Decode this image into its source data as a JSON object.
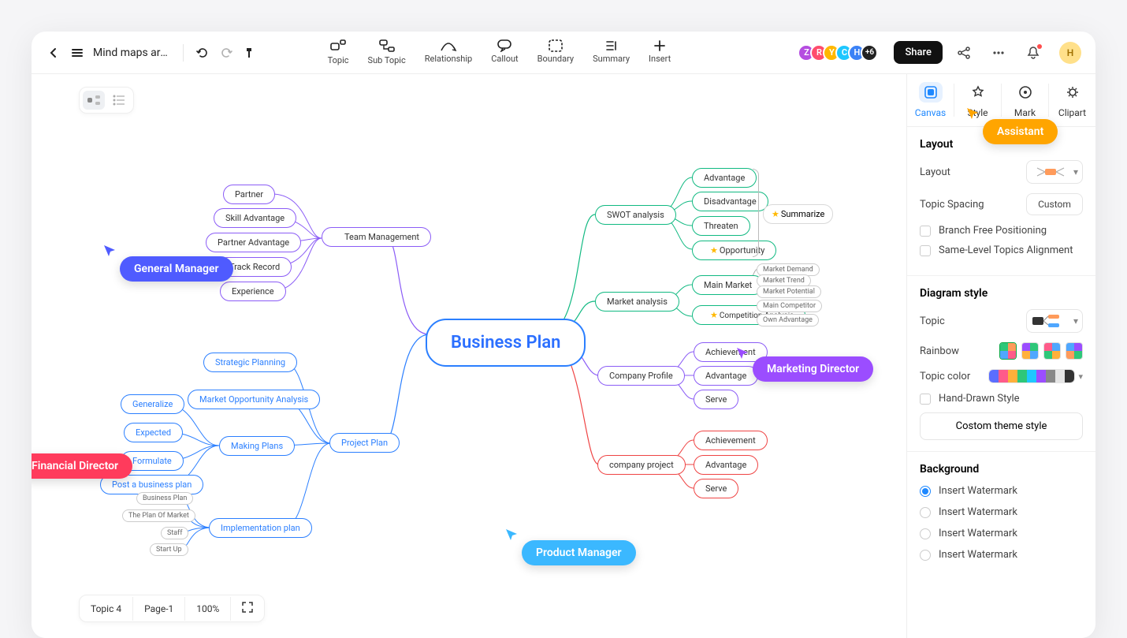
{
  "topbar": {
    "title": "Mind maps are ..."
  },
  "toolbar": [
    {
      "label": "Topic",
      "name": "topic-button"
    },
    {
      "label": "Sub Topic",
      "name": "subtopic-button"
    },
    {
      "label": "Relationship",
      "name": "relationship-button"
    },
    {
      "label": "Callout",
      "name": "callout-button"
    },
    {
      "label": "Boundary",
      "name": "boundary-button"
    },
    {
      "label": "Summary",
      "name": "summary-button"
    },
    {
      "label": "Insert",
      "name": "insert-button"
    }
  ],
  "avatars": [
    "Z",
    "R",
    "Y",
    "C",
    "H"
  ],
  "avatarOverflow": "+6",
  "share": "Share",
  "me": "H",
  "status": {
    "topic": "Topic 4",
    "page": "Page-1",
    "zoom": "100%"
  },
  "panel": {
    "tabs": [
      "Canvas",
      "Style",
      "Mark",
      "Clipart"
    ],
    "layout": {
      "title": "Layout",
      "layoutLabel": "Layout",
      "topicSpacing": "Topic Spacing",
      "custom": "Custom",
      "branchFree": "Branch Free Positioning",
      "sameLevel": "Same-Level Topics Alignment"
    },
    "diagram": {
      "title": "Diagram style",
      "topic": "Topic",
      "rainbow": "Rainbow",
      "topicColor": "Topic color",
      "handDrawn": "Hand-Drawn Style",
      "customTheme": "Costom theme style"
    },
    "background": {
      "title": "Background",
      "options": [
        "Insert Watermark",
        "Insert Watermark",
        "Insert Watermark",
        "Insert Watermark"
      ]
    }
  },
  "map": {
    "root": "Business Plan",
    "left": {
      "team": {
        "label": "Team Management",
        "children": [
          "Partner",
          "Skill Advantage",
          "Partner Advantage",
          "Track Record",
          "Experience"
        ]
      },
      "plan": {
        "label": "Project Plan",
        "children": {
          "strategic": "Strategic Planning",
          "moa": "Market Opportunity Analysis",
          "making": {
            "label": "Making Plans",
            "children": [
              "Generalize",
              "Expected",
              "Formulate",
              "Post a business plan"
            ]
          },
          "impl": {
            "label": "Implementation plan",
            "children": [
              "Business Plan",
              "The Plan Of Market",
              "Staff",
              "Start Up"
            ]
          }
        }
      }
    },
    "right": {
      "swot": {
        "label": "SWOT analysis",
        "children": [
          "Advantage",
          "Disadvantage",
          "Threaten",
          "Opportunity"
        ],
        "summary": "Summarize"
      },
      "market": {
        "label": "Market analysis",
        "children": {
          "main": {
            "label": "Main Market",
            "children": [
              "Market Demand",
              "Market Trend",
              "Market Potential"
            ]
          },
          "comp": {
            "label": "Competition Analysis",
            "children": [
              "Main Competitor",
              "Own Advantage"
            ]
          }
        }
      },
      "profile": {
        "label": "Company Profile",
        "children": [
          "Achievement",
          "Advantage",
          "Serve"
        ]
      },
      "project": {
        "label": "company project",
        "children": [
          "Achievement",
          "Advantage",
          "Serve"
        ]
      }
    }
  },
  "cursors": {
    "gm": "General Manager",
    "fd": "Financial Director",
    "pm": "Product Manager",
    "md": "Marketing Director",
    "as": "Assistant"
  },
  "colors": {
    "palette": [
      "#5b6eff",
      "#ff5b8a",
      "#ffb03b",
      "#2ec779",
      "#1ec7ff",
      "#9b4dff",
      "#888888",
      "#e5e5e5",
      "#333333"
    ]
  }
}
